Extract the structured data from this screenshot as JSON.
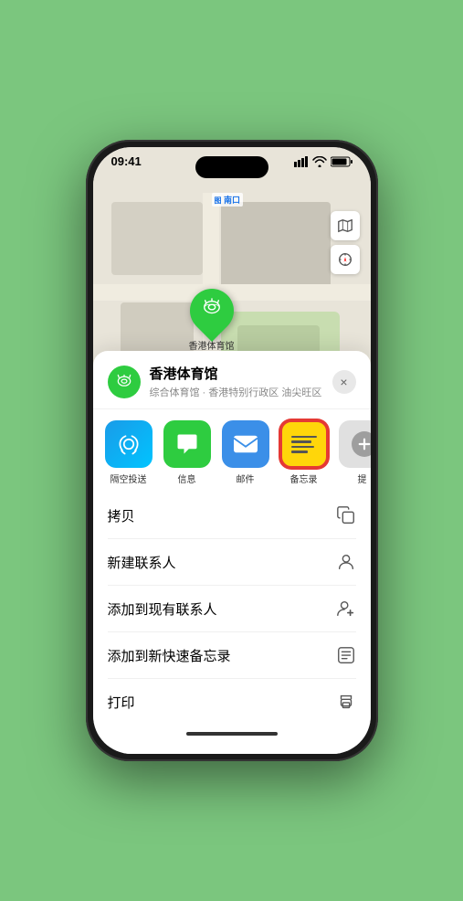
{
  "status_bar": {
    "time": "09:41",
    "location_icon": "▶"
  },
  "map": {
    "label_nankou": "南口"
  },
  "location_card": {
    "name": "香港体育馆",
    "subtitle": "综合体育馆 · 香港特别行政区 油尖旺区",
    "close_label": "×"
  },
  "share_items": [
    {
      "id": "airdrop",
      "label": "隔空投送"
    },
    {
      "id": "messages",
      "label": "信息"
    },
    {
      "id": "mail",
      "label": "邮件"
    },
    {
      "id": "notes",
      "label": "备忘录"
    },
    {
      "id": "more",
      "label": "提"
    }
  ],
  "actions": [
    {
      "label": "拷贝",
      "icon": "📋"
    },
    {
      "label": "新建联系人",
      "icon": "👤"
    },
    {
      "label": "添加到现有联系人",
      "icon": "👤"
    },
    {
      "label": "添加到新快速备忘录",
      "icon": "📝"
    },
    {
      "label": "打印",
      "icon": "🖨"
    }
  ]
}
